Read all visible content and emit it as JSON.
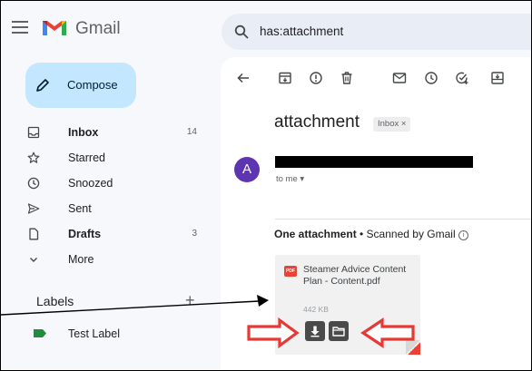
{
  "app": {
    "name": "Gmail"
  },
  "colors": {
    "accent": "#c2e7ff",
    "brand_red": "#ea4335",
    "avatar": "#5e35b1",
    "label_green": "#1e8e3e",
    "annotation_red": "#e53935"
  },
  "search": {
    "query": "has:attachment"
  },
  "compose": {
    "label": "Compose"
  },
  "nav": [
    {
      "label": "Inbox",
      "count": "14",
      "bold": true,
      "icon": "inbox-icon"
    },
    {
      "label": "Starred",
      "count": "",
      "bold": false,
      "icon": "star-icon"
    },
    {
      "label": "Snoozed",
      "count": "",
      "bold": false,
      "icon": "clock-icon"
    },
    {
      "label": "Sent",
      "count": "",
      "bold": false,
      "icon": "send-icon"
    },
    {
      "label": "Drafts",
      "count": "3",
      "bold": true,
      "icon": "draft-icon"
    },
    {
      "label": "More",
      "count": "",
      "bold": false,
      "icon": "chevron-down-icon"
    }
  ],
  "labels": {
    "title": "Labels",
    "add": "+",
    "items": [
      {
        "name": "Test Label",
        "icon": "label-icon"
      }
    ]
  },
  "toolbar": {
    "icons": [
      "back-arrow-icon",
      "archive-icon",
      "report-spam-icon",
      "delete-icon",
      "mark-unread-icon",
      "snooze-icon",
      "add-task-icon",
      "move-to-icon"
    ]
  },
  "message": {
    "subject": "attachment",
    "chip": "Inbox ×",
    "sender_initial": "A",
    "recipient": "to me ▾"
  },
  "attachments": {
    "heading_bold": "One attachment",
    "heading_rest": " • Scanned by Gmail ",
    "info_glyph": "i",
    "file": {
      "badge": "PDF",
      "name": "Steamer Advice Content Plan - Content.pdf",
      "size": "442 KB"
    },
    "actions": [
      "download-icon",
      "save-to-drive-icon"
    ]
  }
}
